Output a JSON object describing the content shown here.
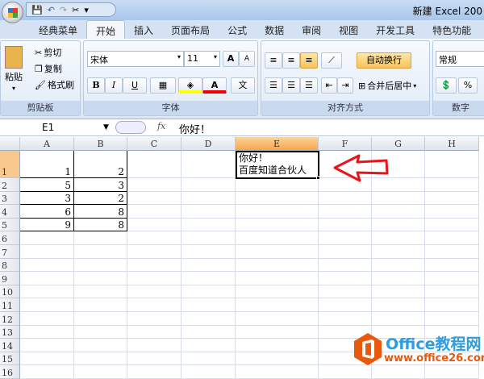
{
  "window": {
    "title": "新建 Excel 200"
  },
  "qat": {
    "save": "💾",
    "undo": "↶",
    "redo": "↷",
    "tools": "✂",
    "more": "▾"
  },
  "tabs": [
    "经典菜单",
    "开始",
    "插入",
    "页面布局",
    "公式",
    "数据",
    "审阅",
    "视图",
    "开发工具",
    "特色功能"
  ],
  "clipboard": {
    "paste": "粘贴",
    "cut": "剪切",
    "copy": "复制",
    "format_painter": "格式刷",
    "label": "剪贴板"
  },
  "font": {
    "name": "宋体",
    "size": "11",
    "grow": "A",
    "shrink": "A",
    "bold": "B",
    "italic": "I",
    "underline": "U",
    "label": "字体",
    "phonetic": "文"
  },
  "alignment": {
    "wrap": "自动换行",
    "merge": "合并后居中",
    "label": "对齐方式"
  },
  "number": {
    "format": "常规",
    "percent": "%",
    "label": "数字"
  },
  "formula_bar": {
    "name_box": "E1",
    "fx": "fx",
    "value": "你好！"
  },
  "columns": [
    "A",
    "B",
    "C",
    "D",
    "E",
    "F",
    "G",
    "H"
  ],
  "rows": [
    "1",
    "2",
    "3",
    "4",
    "5",
    "6",
    "7",
    "8",
    "9",
    "10",
    "11",
    "12",
    "13",
    "14",
    "15",
    "16"
  ],
  "cells": {
    "A": [
      "1",
      "5",
      "3",
      "6",
      "9"
    ],
    "B": [
      "2",
      "3",
      "2",
      "8",
      "8"
    ]
  },
  "e1": {
    "line1": "你好！",
    "line2": "百度知道合伙人"
  },
  "watermark": {
    "brand": "Office教程网",
    "url": "www.office26.com"
  },
  "colors": {
    "arrow": "#e8141c",
    "accent": "#f7a64f",
    "logo": "#e8590c"
  }
}
